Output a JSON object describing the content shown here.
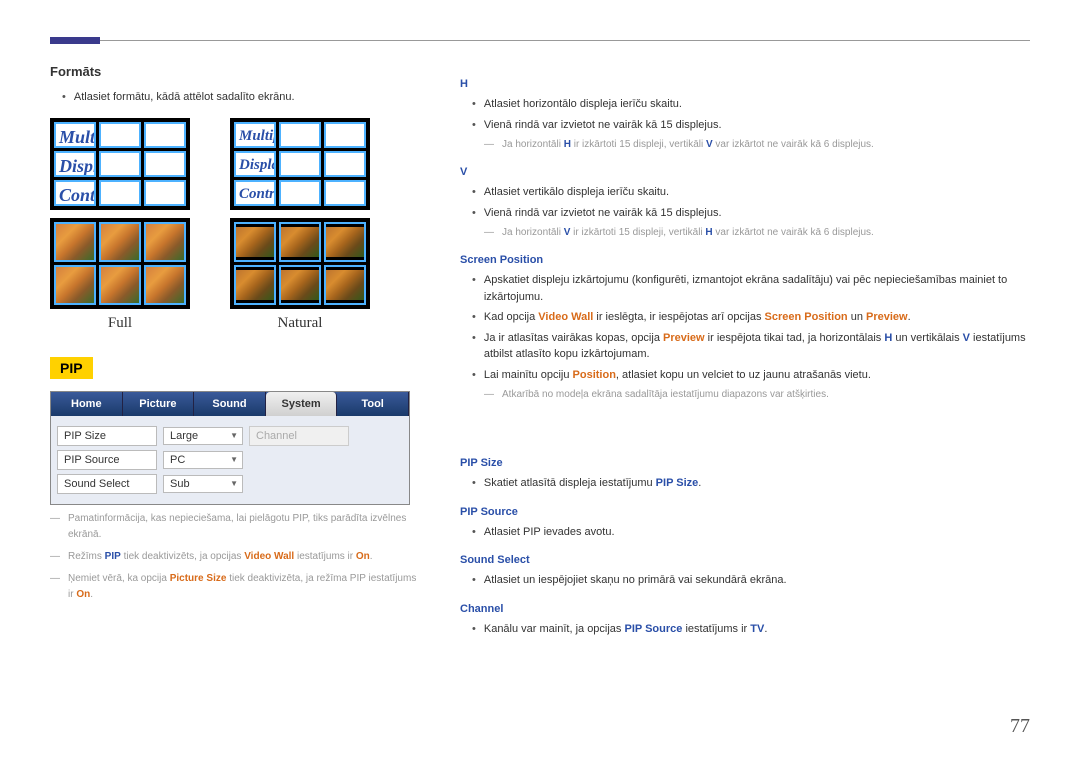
{
  "left": {
    "formats_title": "Formāts",
    "formats_bullet": "Atlasiet formātu, kādā attēlot sadalīto ekrānu.",
    "mdc_line1": "Multiple",
    "mdc_line2": "Display",
    "mdc_line3": "Control",
    "full_label": "Full",
    "natural_label": "Natural",
    "pip_badge": "PIP",
    "tabs": {
      "home": "Home",
      "picture": "Picture",
      "sound": "Sound",
      "system": "System",
      "tool": "Tool"
    },
    "pip_rows": {
      "size_label": "PIP Size",
      "size_value": "Large",
      "channel_label": "Channel",
      "source_label": "PIP Source",
      "source_value": "PC",
      "sound_label": "Sound Select",
      "sound_value": "Sub"
    },
    "notes": {
      "n1": "Pamatinformācija, kas nepieciešama, lai pielāgotu PIP, tiks parādīta izvēlnes ekrānā.",
      "n2a": "Režīms ",
      "n2b": "PIP",
      "n2c": " tiek deaktivizēts, ja opcijas ",
      "n2d": "Video Wall",
      "n2e": " iestatījums ir ",
      "n2f": "On",
      "n2g": ".",
      "n3a": "Ņemiet vērā, ka opcija ",
      "n3b": "Picture Size",
      "n3c": " tiek deaktivizēta, ja režīma PIP iestatījums ir ",
      "n3d": "On",
      "n3e": "."
    }
  },
  "right": {
    "h_head": "H",
    "h_b1": "Atlasiet horizontālo displeja ierīču skaitu.",
    "h_b2": "Vienā rindā var izvietot ne vairāk kā 15 displejus.",
    "h_note_a": "Ja horizontāli ",
    "h_note_b": "H",
    "h_note_c": " ir izkārtoti 15 displeji, vertikāli ",
    "h_note_d": "V",
    "h_note_e": " var izkārtot ne vairāk kā 6 displejus.",
    "v_head": "V",
    "v_b1": "Atlasiet vertikālo displeja ierīču skaitu.",
    "v_b2": "Vienā rindā var izvietot ne vairāk kā 15 displejus.",
    "v_note_a": "Ja horizontāli ",
    "v_note_b": "V",
    "v_note_c": " ir izkārtoti 15 displeji, vertikāli ",
    "v_note_d": "H",
    "v_note_e": " var izkārtot ne vairāk kā 6 displejus.",
    "sp_head": "Screen Position",
    "sp_b1": "Apskatiet displeju izkārtojumu (konfigurēti, izmantojot ekrāna sadalītāju) vai pēc nepieciešamības mainiet to izkārtojumu.",
    "sp_b2a": "Kad opcija ",
    "sp_b2b": "Video Wall",
    "sp_b2c": " ir ieslēgta, ir iespējotas arī opcijas ",
    "sp_b2d": "Screen Position",
    "sp_b2e": " un ",
    "sp_b2f": "Preview",
    "sp_b2g": ".",
    "sp_b3a": "Ja ir atlasītas vairākas kopas, opcija ",
    "sp_b3b": "Preview",
    "sp_b3c": " ir iespējota tikai tad, ja horizontālais ",
    "sp_b3d": "H",
    "sp_b3e": " un vertikālais ",
    "sp_b3f": "V",
    "sp_b3g": " iestatījums atbilst atlasīto kopu izkārtojumam.",
    "sp_b4a": "Lai mainītu opciju ",
    "sp_b4b": "Position",
    "sp_b4c": ", atlasiet kopu un velciet to uz jaunu atrašanās vietu.",
    "sp_note": "Atkarībā no modeļa ekrāna sadalītāja iestatījumu diapazons var atšķirties.",
    "pipsize_head": "PIP Size",
    "pipsize_b1a": "Skatiet atlasītā displeja iestatījumu ",
    "pipsize_b1b": "PIP Size",
    "pipsize_b1c": ".",
    "pipsource_head": "PIP Source",
    "pipsource_b1": "Atlasiet PIP ievades avotu.",
    "soundsel_head": "Sound Select",
    "soundsel_b1": "Atlasiet un iespējojiet skaņu no primārā vai sekundārā ekrāna.",
    "channel_head": "Channel",
    "channel_b1a": "Kanālu var mainīt, ja opcijas ",
    "channel_b1b": "PIP Source",
    "channel_b1c": " iestatījums ir ",
    "channel_b1d": "TV",
    "channel_b1e": "."
  },
  "page": "77"
}
